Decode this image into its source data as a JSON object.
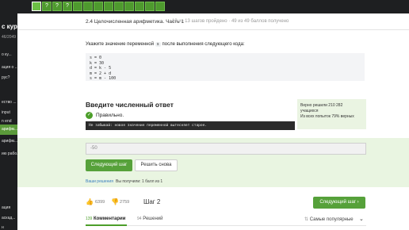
{
  "sidebar": {
    "title": "с курс",
    "progress": "46/2049",
    "items": [
      {
        "label": "о ку..."
      },
      {
        "label": "ация о ..."
      },
      {
        "label": "рус?"
      },
      {
        "label": "ество ..."
      },
      {
        "label": "input"
      },
      {
        "label": "n end"
      },
      {
        "label": "арифм..."
      },
      {
        "label": "арифм..."
      },
      {
        "label": "ию рабо..."
      },
      {
        "label": "ация"
      },
      {
        "label": "аскад..."
      },
      {
        "label": "н"
      }
    ],
    "active_index": 6
  },
  "topbar": {
    "steps": [
      "",
      "?",
      "?",
      "?",
      "",
      "",
      "",
      "",
      "",
      "",
      "",
      "",
      ""
    ],
    "current_index": 0
  },
  "lesson": {
    "title": "2.4 Целочисленная арифметика. Часть 1",
    "meta": "13 из 13 шагов пройдено · 49 из 49 баллов  получено"
  },
  "question": {
    "prefix": "Укажите значение переменной",
    "variable": "s",
    "suffix": "после выполнения следующего кода:"
  },
  "code": [
    "s = 0",
    "k = 30",
    "d = k - 5",
    "m = 2 + d",
    "s = m - 100"
  ],
  "answer": {
    "heading": "Введите численный ответ",
    "status": "Правильно.",
    "hint": "Не забывай: новое значение переменной вытесняет старое.",
    "value": "-50",
    "next_label": "Следующий шаг",
    "retry_label": "Решить снова",
    "solved_link": "Ваши решения",
    "received": "Вы получили: 1 балл из 1"
  },
  "stats": {
    "line1": "Верно решили 210 282",
    "line2": "учащихся",
    "line3": "Из всех попыток 79% верных"
  },
  "footer": {
    "likes": "6399",
    "dislikes": "2759",
    "step_label": "Шаг 2",
    "next_label": "Следующий шаг",
    "comments_count": "139",
    "comments_label": "Комментарии",
    "solutions_count": "94",
    "solutions_label": "Решений",
    "sort_label": "Самые популярные"
  },
  "colors": {
    "accent": "#56a13a",
    "answer_band": "#e9f5e1",
    "sidebar_bg": "#1e1f21"
  }
}
